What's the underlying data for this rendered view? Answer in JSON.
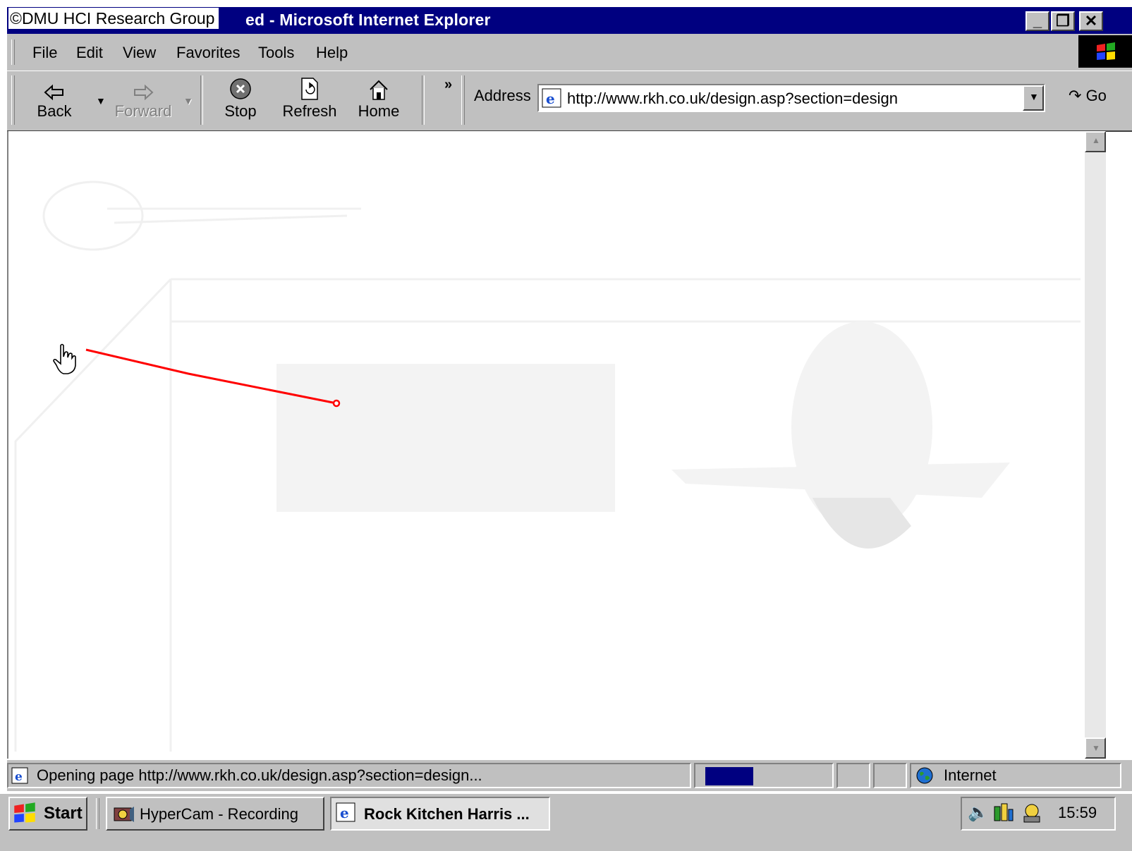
{
  "window": {
    "watermark": "©DMU HCI Research Group",
    "title_visible": "ed - Microsoft Internet Explorer",
    "controls": [
      "_",
      "❐",
      "✕"
    ]
  },
  "menu": [
    "File",
    "Edit",
    "View",
    "Favorites",
    "Tools",
    "Help"
  ],
  "toolbar": {
    "back": "Back",
    "forward": "Forward",
    "stop": "Stop",
    "refresh": "Refresh",
    "home": "Home",
    "more": "»",
    "address_label": "Address",
    "address_url": "http://www.rkh.co.uk/design.asp?section=design",
    "go_label": "Go"
  },
  "status": {
    "message": "Opening page http://www.rkh.co.uk/design.asp?section=design...",
    "zone": "Internet"
  },
  "taskbar": {
    "start": "Start",
    "task_recording": "HyperCam - Recording",
    "task_active": "Rock Kitchen Harris ...",
    "clock": "15:59"
  },
  "colors": {
    "titlebar": "#000080",
    "chrome": "#c0c0c0",
    "annotation_line": "#ff0000"
  }
}
